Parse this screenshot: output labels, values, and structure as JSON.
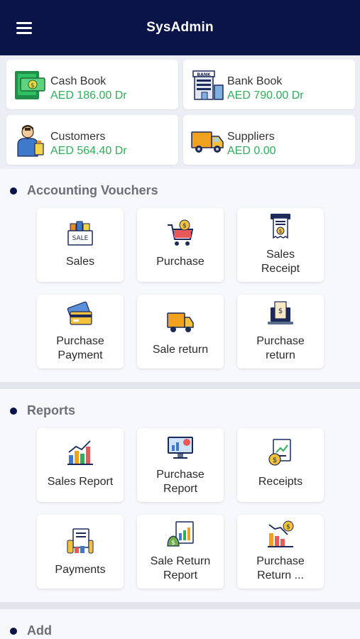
{
  "header": {
    "title": "SysAdmin",
    "menu_icon": "hamburger-menu-icon"
  },
  "summary": {
    "cash_book": {
      "label": "Cash Book",
      "value": "AED 186.00 Dr",
      "icon": "cash-book-icon"
    },
    "bank_book": {
      "label": "Bank Book",
      "value": "AED 790.00 Dr",
      "icon": "bank-building-icon"
    },
    "customers": {
      "label": "Customers",
      "value": "AED 564.40 Dr",
      "icon": "customer-person-icon"
    },
    "suppliers": {
      "label": "Suppliers",
      "value": "AED 0.00",
      "icon": "delivery-truck-icon"
    },
    "value_color": "#2fae5a"
  },
  "accounting": {
    "title": "Accounting Vouchers",
    "tiles": [
      {
        "line1": "Sales",
        "line2": "",
        "icon": "sale-shop-icon"
      },
      {
        "line1": "Purchase",
        "line2": "",
        "icon": "shopping-cart-icon"
      },
      {
        "line1": "Sales",
        "line2": "Receipt",
        "icon": "receipt-printer-icon"
      },
      {
        "line1": "Purchase",
        "line2": "Payment",
        "icon": "credit-card-icon"
      },
      {
        "line1": "Sale return",
        "line2": "",
        "icon": "return-truck-icon"
      },
      {
        "line1": "Purchase",
        "line2": "return",
        "icon": "laptop-invoice-icon"
      }
    ]
  },
  "reports": {
    "title": "Reports",
    "tiles": [
      {
        "line1": "Sales Report",
        "line2": "",
        "icon": "bar-chart-icon"
      },
      {
        "line1": "Purchase",
        "line2": "Report",
        "icon": "monitor-chart-icon"
      },
      {
        "line1": "Receipts",
        "line2": "",
        "icon": "receipt-coin-icon"
      },
      {
        "line1": "Payments",
        "line2": "",
        "icon": "payment-coins-icon"
      },
      {
        "line1": "Sale Return",
        "line2": "Report",
        "icon": "money-bag-chart-icon"
      },
      {
        "line1": "Purchase",
        "line2": "Return ...",
        "icon": "declining-chart-icon"
      }
    ]
  },
  "add": {
    "title": "Add"
  },
  "brand_color": "#0b1448"
}
